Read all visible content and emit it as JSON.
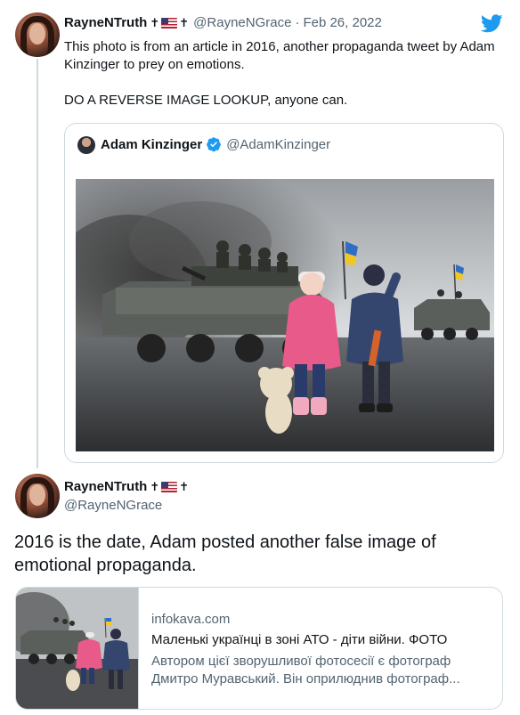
{
  "tweet1": {
    "display_name": "RayneNTruth",
    "cross_left": "✝",
    "cross_right": "✝",
    "handle": "@RayneNGrace",
    "separator": "·",
    "date": "Feb 26, 2022",
    "text": "This photo is from an article in 2016, another propaganda tweet by Adam Kinzinger to prey on emotions.\n\nDO A REVERSE IMAGE LOOKUP, anyone can."
  },
  "quote": {
    "display_name": "Adam Kinzinger",
    "handle": "@AdamKinzinger"
  },
  "tweet2": {
    "display_name": "RayneNTruth",
    "cross_left": "✝",
    "cross_right": "✝",
    "handle": "@RayneNGrace",
    "text": "2016 is the date, Adam posted another false image of emotional propaganda."
  },
  "link_card": {
    "domain": "infokava.com",
    "title": "Маленькі українці в зоні АТО - діти війни. ФОТО",
    "description": "Автором цієї зворушливої фотосесії є фотограф Дмитро Муравський. Він оприлюднив фотограф..."
  },
  "icons": {
    "brand": "twitter-bird-icon",
    "verified": "verified-badge-icon",
    "flag": "us-flag-icon"
  },
  "colors": {
    "twitter_blue": "#1d9bf0",
    "text_primary": "#0f1419",
    "text_secondary": "#536471",
    "border": "#cfd9de"
  }
}
